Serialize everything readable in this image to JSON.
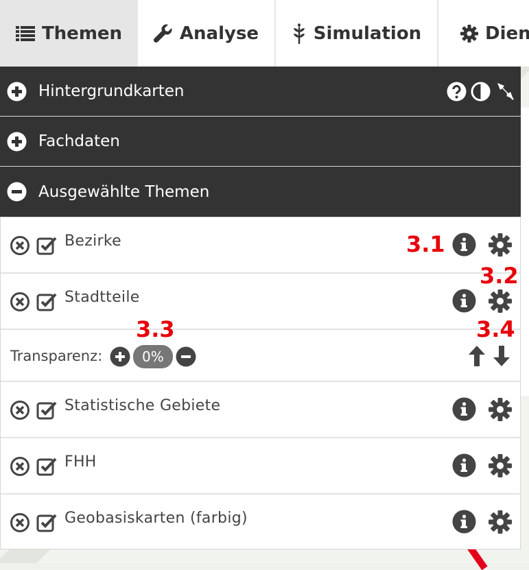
{
  "tabs": [
    {
      "label": "Themen",
      "icon": "list-icon",
      "active": true
    },
    {
      "label": "Analyse",
      "icon": "wrench-icon",
      "active": false
    },
    {
      "label": "Simulation",
      "icon": "sprout-icon",
      "active": false
    },
    {
      "label": "Diens",
      "icon": "gear-icon",
      "active": false
    }
  ],
  "sections": {
    "background_maps": "Hintergrundkarten",
    "subject_data": "Fachdaten",
    "selected_themes": "Ausgewählte Themen"
  },
  "layers": [
    {
      "name": "Bezirke"
    },
    {
      "name": "Stadtteile",
      "expanded": true
    },
    {
      "name": "Statistische Gebiete"
    },
    {
      "name": "FHH"
    },
    {
      "name": "Geobasiskarten (farbig)"
    }
  ],
  "transparency": {
    "label": "Transparenz:",
    "value": "0%"
  },
  "annotations": [
    "3.1",
    "3.2",
    "3.3",
    "3.4"
  ],
  "colors": {
    "header_bg": "#333333",
    "annotation": "#e8000b",
    "pill": "#777777"
  }
}
